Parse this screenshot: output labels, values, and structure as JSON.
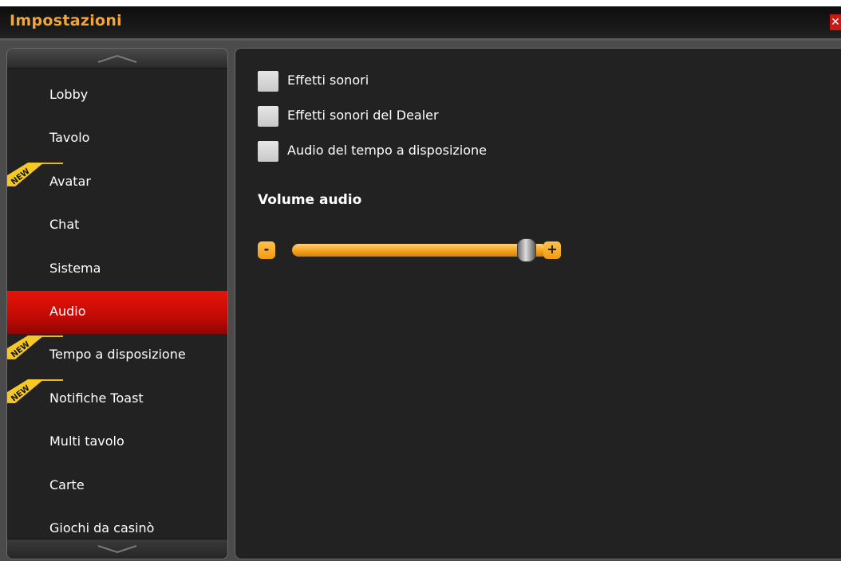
{
  "window": {
    "title": "Impostazioni",
    "close_label": "✕"
  },
  "sidebar": {
    "items": [
      {
        "label": "Lobby",
        "is_new": false,
        "active": false
      },
      {
        "label": "Tavolo",
        "is_new": false,
        "active": false
      },
      {
        "label": "Avatar",
        "is_new": true,
        "active": false
      },
      {
        "label": "Chat",
        "is_new": false,
        "active": false
      },
      {
        "label": "Sistema",
        "is_new": false,
        "active": false
      },
      {
        "label": "Audio",
        "is_new": false,
        "active": true
      },
      {
        "label": "Tempo a disposizione",
        "is_new": true,
        "active": false
      },
      {
        "label": "Notifiche Toast",
        "is_new": true,
        "active": false
      },
      {
        "label": "Multi tavolo",
        "is_new": false,
        "active": false
      },
      {
        "label": "Carte",
        "is_new": false,
        "active": false
      },
      {
        "label": "Giochi da casinò",
        "is_new": false,
        "active": false
      }
    ],
    "new_badge": "NEW"
  },
  "audio": {
    "options": [
      {
        "label": "Effetti sonori",
        "checked": false
      },
      {
        "label": "Effetti sonori del Dealer",
        "checked": false
      },
      {
        "label": "Audio del tempo a disposizione",
        "checked": false
      }
    ],
    "volume_title": "Volume audio",
    "volume_minus": "-",
    "volume_plus": "+",
    "volume_level": 0.92
  },
  "colors": {
    "accent": "#f0a63a",
    "active_item": "#d60f06",
    "slider": "#f4a21b"
  }
}
